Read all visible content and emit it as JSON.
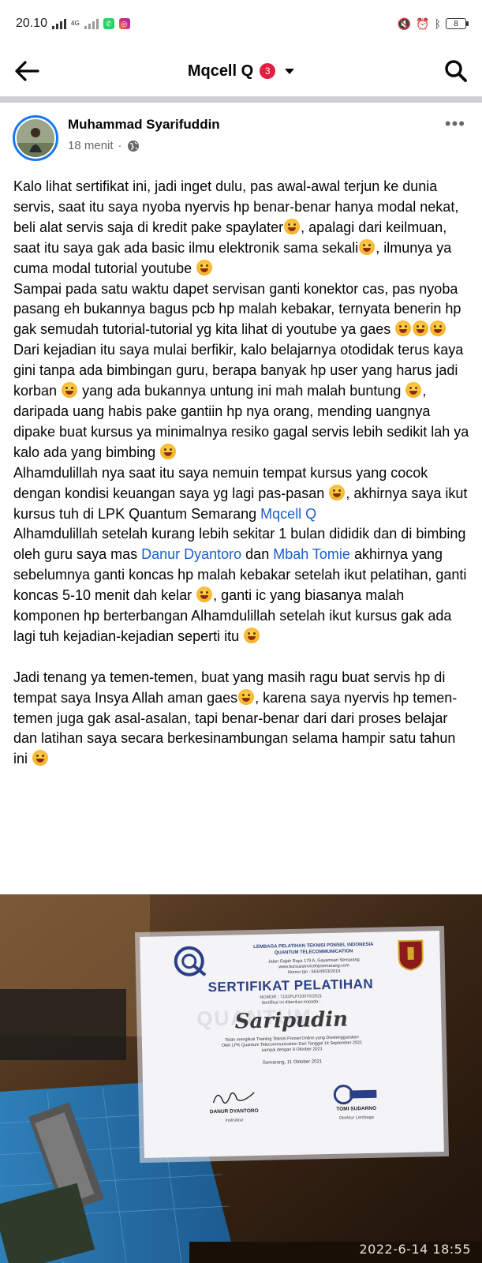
{
  "status_bar": {
    "time": "20.10",
    "network_small": "4G",
    "battery": "8"
  },
  "header": {
    "title": "Mqcell Q",
    "badge": "3"
  },
  "post": {
    "author": "Muhammad Syarifuddin",
    "time": "18 menit",
    "paragraphs": {
      "p1": "Kalo lihat sertifikat ini, jadi inget dulu, pas awal-awal terjun ke dunia servis, saat itu saya nyoba nyervis hp benar-benar hanya modal nekat, beli alat servis saja  di kredit pake spaylater",
      "p1b": ", apalagi dari keilmuan, saat itu saya gak ada basic ilmu elektronik sama sekali",
      "p1c": ", ilmunya ya cuma modal tutorial youtube",
      "p2": "Sampai pada satu waktu dapet servisan ganti konektor cas, pas nyoba pasang eh bukannya bagus pcb hp malah kebakar, ternyata benerin hp gak semudah tutorial-tutorial yg kita lihat di youtube ya gaes",
      "p3": "Dari kejadian itu saya mulai berfikir, kalo belajarnya otodidak terus kaya gini tanpa ada bimbingan guru, berapa banyak hp user yang harus jadi korban",
      "p3b": " yang ada bukannya untung ini mah malah buntung",
      "p3c": ", daripada uang habis pake gantiin hp nya orang, mending uangnya dipake buat kursus ya minimalnya resiko gagal servis lebih sedikit lah ya  kalo ada yang bimbing",
      "p4": "Alhamdulillah nya saat itu saya nemuin tempat kursus yang cocok dengan kondisi keuangan saya yg lagi pas-pasan",
      "p4b": ", akhirnya saya ikut kursus tuh di LPK Quantum Semarang ",
      "p4_mention": "Mqcell Q",
      "p5": "Alhamdulillah setelah kurang lebih sekitar 1 bulan dididik dan di bimbing oleh guru saya mas ",
      "p5_mention1": "Danur Dyantoro",
      "p5_and": "  dan ",
      "p5_mention2": "Mbah Tomie",
      "p5b": " akhirnya yang sebelumnya ganti koncas hp malah kebakar setelah ikut pelatihan, ganti koncas 5-10 menit dah kelar",
      "p5c": ", ganti ic yang biasanya malah komponen hp berterbangan Alhamdulillah setelah ikut  kursus gak ada lagi tuh kejadian-kejadian seperti itu",
      "p6": "Jadi tenang ya temen-temen, buat yang masih ragu buat servis hp di tempat saya Insya Allah  aman gaes",
      "p6b": ", karena saya nyervis hp temen-temen juga gak asal-asalan, tapi benar-benar dari dari proses belajar dan latihan saya secara berkesinambungan selama hampir satu tahun ini "
    }
  },
  "photo": {
    "timestamp": "2022-6-14  18:55",
    "certificate": {
      "org_line1": "LEMBAGA PELATIHAN TEKNISI PONSEL INDONESIA",
      "org_line2": "QUANTUM TELECOMMUNICATION",
      "address": "Jalan Gajah Raya 179 A, Gayamsari Semarang",
      "website": "www.kursusservicehpsemarang.com",
      "license": "Nomor Ijin : 563/4503/2019",
      "title": "SERTIFIKAT PELATIHAN",
      "number": "NOMOR : 7102PLP/10070/2021",
      "given_to": "Sertifikat ini diberikan kepada :",
      "recipient": "Saripudin",
      "desc1": "Telah mengikuti Training Teknisi Ponsel Online yang Diselenggarakan",
      "desc2": "Oleh LPK Quantum Telecommunication Dari Tanggal 14 September 2021",
      "desc3": "sampai dengan 9 Oktober 2021",
      "date": "Semarang, 11 Oktober 2021",
      "signer1": "DANUR DYANTORO",
      "role1": "Instruktur",
      "signer2": "TOMI SUDARNO",
      "role2": "Direktur Lembaga",
      "watermark": "QUANTUM"
    }
  }
}
